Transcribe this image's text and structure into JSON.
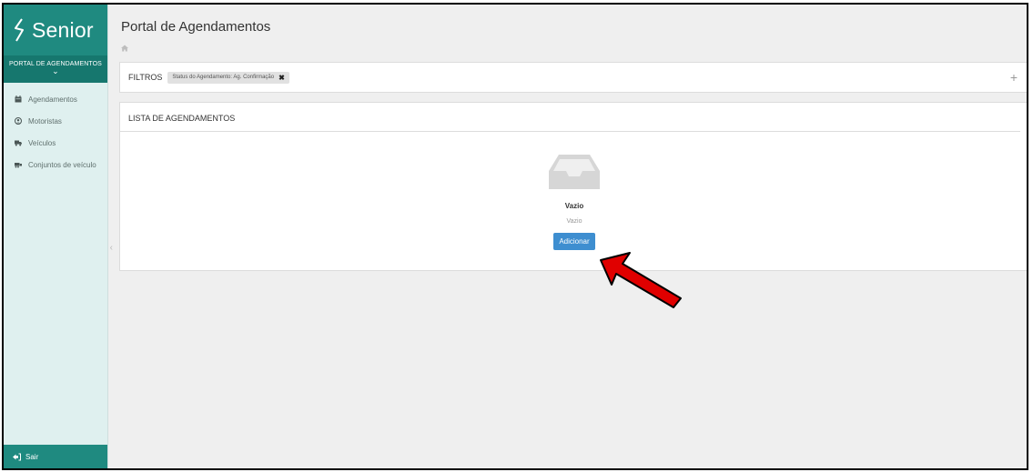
{
  "sidebar": {
    "logo_text": "Senior",
    "portal_label": "PORTAL DE AGENDAMENTOS",
    "items": [
      {
        "label": "Agendamentos",
        "icon": "calendar-icon"
      },
      {
        "label": "Motoristas",
        "icon": "user-circle-icon"
      },
      {
        "label": "Veículos",
        "icon": "truck-icon"
      },
      {
        "label": "Conjuntos de veículo",
        "icon": "vehicle-set-icon"
      }
    ],
    "logout_label": "Sair"
  },
  "header": {
    "title": "Portal de Agendamentos"
  },
  "filters": {
    "label": "FILTROS",
    "chip": "Status do Agendamento: Ag. Confirmação"
  },
  "list": {
    "title": "LISTA DE AGENDAMENTOS",
    "empty_title": "Vazio",
    "empty_subtitle": "Vazio",
    "add_button": "Adicionar"
  },
  "colors": {
    "brand": "#1f8a80",
    "brand_dark": "#16776e",
    "sidebar_bg": "#dff0ef",
    "button": "#3e8ed0",
    "annotation_arrow": "#e00000"
  }
}
